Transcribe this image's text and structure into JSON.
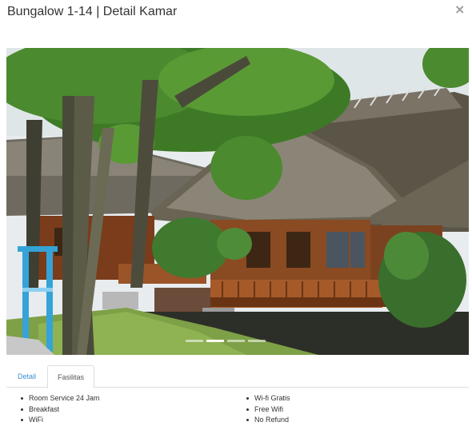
{
  "modal": {
    "title": "Bungalow 1-14 | Detail Kamar",
    "close_icon": "close-icon"
  },
  "gallery": {
    "slide_count": 4,
    "active_slide": 1
  },
  "tabs": [
    {
      "label": "Detail",
      "active": false
    },
    {
      "label": "Fasilitas",
      "active": true
    }
  ],
  "facilities": {
    "left": [
      "Room Service 24 Jam",
      "Breakfast",
      "WiFi"
    ],
    "right": [
      "Wi-fi Gratis",
      "Free Wifi",
      "No Refund"
    ]
  },
  "colors": {
    "tab_link": "#3a8fd0",
    "border": "#dddddd",
    "title_text": "#333333"
  }
}
